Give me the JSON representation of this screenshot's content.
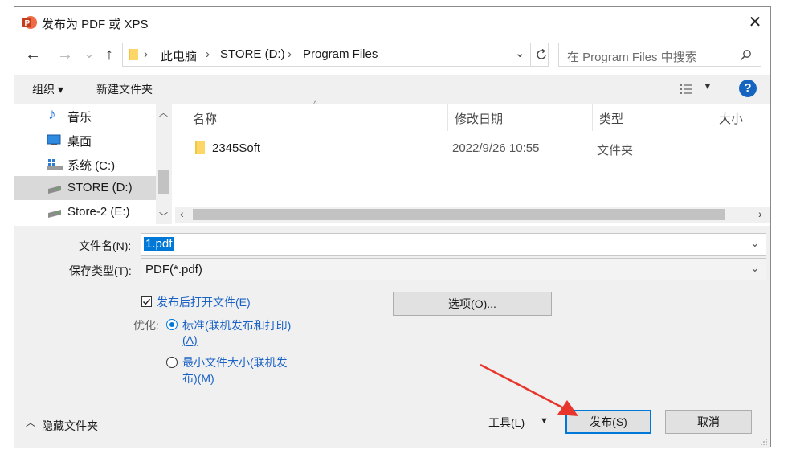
{
  "window": {
    "title": "发布为 PDF 或 XPS",
    "close_glyph": "✕"
  },
  "nav": {
    "back_glyph": "←",
    "forward_glyph": "→",
    "up_glyph": "↑",
    "recent_glyph": "⌄"
  },
  "address": {
    "segments": [
      "此电脑",
      "STORE (D:)",
      "Program Files"
    ],
    "separator": "›"
  },
  "search": {
    "placeholder": "在 Program Files 中搜索"
  },
  "toolbar": {
    "organize": "组织 ▾",
    "new_folder": "新建文件夹",
    "help": "?"
  },
  "sidebar": {
    "items": [
      {
        "label": "音乐",
        "icon": "music-icon"
      },
      {
        "label": "桌面",
        "icon": "desktop-icon"
      },
      {
        "label": "系统 (C:)",
        "icon": "system-drive-icon"
      },
      {
        "label": "STORE (D:)",
        "icon": "drive-icon",
        "selected": true
      },
      {
        "label": "Store-2 (E:)",
        "icon": "drive-icon"
      }
    ]
  },
  "file_list": {
    "columns": [
      "名称",
      "修改日期",
      "类型",
      "大小"
    ],
    "rows": [
      {
        "name": "2345Soft",
        "modified": "2022/9/26 10:55",
        "type": "文件夹",
        "size": ""
      }
    ]
  },
  "form": {
    "filename_label": "文件名(N):",
    "filename_value": "1.pdf",
    "filetype_label": "保存类型(T):",
    "filetype_value": "PDF(*.pdf)",
    "open_after_label": "发布后打开文件(E)",
    "open_after_checked": true,
    "options_button": "选项(O)...",
    "optimize_label": "优化:",
    "radio_standard_line1": "标准(联机发布和打印)",
    "radio_standard_line2": "(A)",
    "radio_min_line1": "最小文件大小(联机发",
    "radio_min_line2": "布)(M)",
    "selected_option": "standard"
  },
  "footer": {
    "hide_folders": "隐藏文件夹",
    "tools": "工具(L)",
    "publish": "发布(S)",
    "cancel": "取消"
  },
  "colors": {
    "accent": "#0078d7",
    "annotation_arrow": "#e8352b"
  }
}
